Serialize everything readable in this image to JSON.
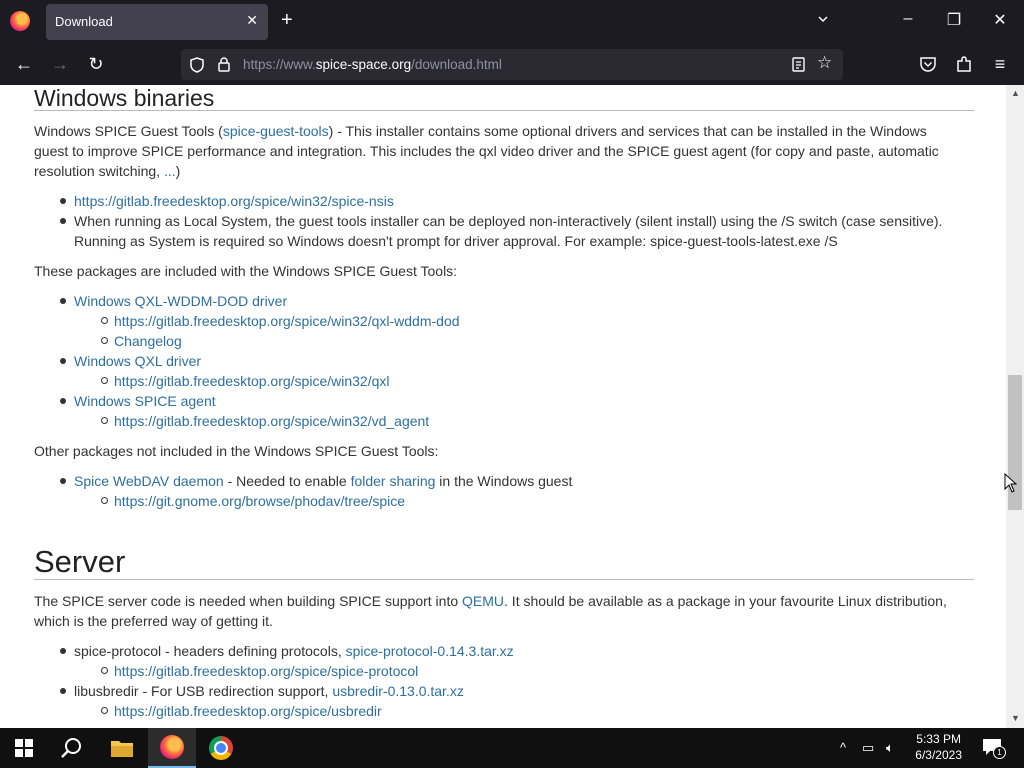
{
  "browser": {
    "tab_title": "Download",
    "url_prefix": "https://www.",
    "url_domain": "spice-space.org",
    "url_path": "/download.html"
  },
  "page": {
    "windows": {
      "heading": "Windows binaries",
      "intro_pre": "Windows SPICE Guest Tools (",
      "intro_link": "spice-guest-tools",
      "intro_post": ") - This installer contains some optional drivers and services that can be installed in the Windows guest to improve SPICE performance and integration. This includes the qxl video driver and the SPICE guest agent (for copy and paste, automatic resolution switching, ",
      "intro_ellipsis": "...",
      "intro_end": ")",
      "nsis_link": "https://gitlab.freedesktop.org/spice/win32/spice-nsis",
      "local_system_text": "When running as Local System, the guest tools installer can be deployed non-interactively (silent install) using the /S switch (case sensitive). Running as System is required so Windows doesn't prompt for driver approval. For example: spice-guest-tools-latest.exe /S",
      "included_text": "These packages are included with the Windows SPICE Guest Tools:",
      "wddm_link": "Windows QXL-WDDM-DOD driver",
      "wddm_repo": "https://gitlab.freedesktop.org/spice/win32/qxl-wddm-dod",
      "changelog": "Changelog",
      "qxl_link": "Windows QXL driver",
      "qxl_repo": "https://gitlab.freedesktop.org/spice/win32/qxl",
      "agent_link": "Windows SPICE agent",
      "agent_repo": "https://gitlab.freedesktop.org/spice/win32/vd_agent",
      "other_text": "Other packages not included in the Windows SPICE Guest Tools:",
      "webdav_link": "Spice WebDAV daemon",
      "webdav_mid": " - Needed to enable ",
      "folder_link": "folder sharing",
      "webdav_end": " in the Windows guest",
      "phodav_repo": "https://git.gnome.org/browse/phodav/tree/spice"
    },
    "server": {
      "heading": "Server",
      "intro_pre": "The SPICE server code is needed when building SPICE support into ",
      "qemu_link": "QEMU",
      "intro_post": ". It should be available as a package in your favourite Linux distribution, which is the preferred way of getting it.",
      "protocol_text": "spice-protocol - headers defining protocols, ",
      "protocol_link": "spice-protocol-0.14.3.tar.xz",
      "protocol_repo": "https://gitlab.freedesktop.org/spice/spice-protocol",
      "usbredir_text": "libusbredir - For USB redirection support, ",
      "usbredir_link": "usbredir-0.13.0.tar.xz",
      "usbredir_repo": "https://gitlab.freedesktop.org/spice/usbredir"
    }
  },
  "taskbar": {
    "time": "5:33 PM",
    "date": "6/3/2023",
    "notification_count": "1"
  }
}
